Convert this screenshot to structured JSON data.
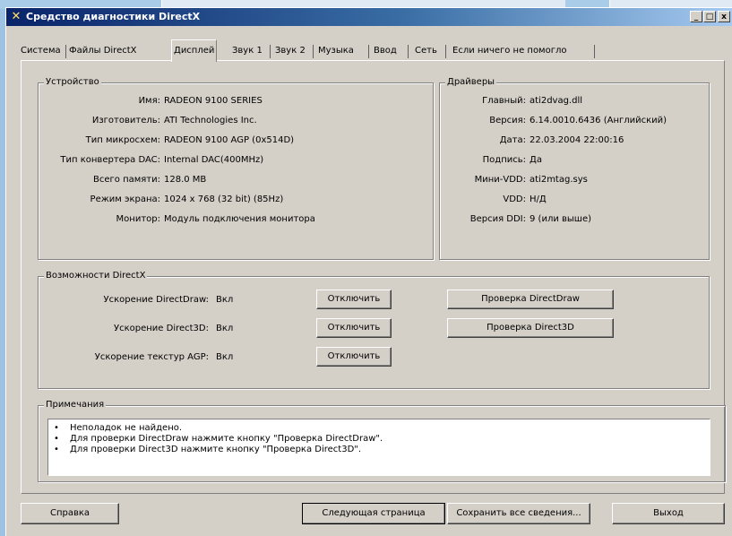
{
  "window": {
    "title": "Средство диагностики DirectX",
    "controls": {
      "minimize": "_",
      "maximize": "□",
      "close": "x"
    }
  },
  "tabs": [
    "Система",
    "Файлы DirectX",
    "Дисплей",
    "Звук 1",
    "Звук 2",
    "Музыка",
    "Ввод",
    "Сеть",
    "Если ничего не помогло"
  ],
  "active_tab": "Дисплей",
  "device": {
    "title": "Устройство",
    "rows": [
      {
        "label": "Имя:",
        "value": "RADEON 9100 SERIES"
      },
      {
        "label": "Изготовитель:",
        "value": "ATI Technologies Inc."
      },
      {
        "label": "Тип микросхем:",
        "value": "RADEON 9100 AGP (0x514D)"
      },
      {
        "label": "Тип конвертера DAC:",
        "value": "Internal DAC(400MHz)"
      },
      {
        "label": "Всего памяти:",
        "value": "128.0 MB"
      },
      {
        "label": "Режим экрана:",
        "value": "1024 x 768 (32 bit) (85Hz)"
      },
      {
        "label": "Монитор:",
        "value": "Модуль подключения монитора"
      }
    ]
  },
  "drivers": {
    "title": "Драйверы",
    "rows": [
      {
        "label": "Главный:",
        "value": "ati2dvag.dll"
      },
      {
        "label": "Версия:",
        "value": "6.14.0010.6436 (Английский)"
      },
      {
        "label": "Дата:",
        "value": "22.03.2004 22:00:16"
      },
      {
        "label": "Подпись:",
        "value": "Да"
      },
      {
        "label": "Мини-VDD:",
        "value": "ati2mtag.sys"
      },
      {
        "label": "VDD:",
        "value": "Н/Д"
      },
      {
        "label": "Версия DDI:",
        "value": "9 (или выше)"
      }
    ]
  },
  "features": {
    "title": "Возможности DirectX",
    "rows": [
      {
        "label": "Ускорение DirectDraw:",
        "value": "Вкл",
        "button": "Отключить"
      },
      {
        "label": "Ускорение Direct3D:",
        "value": "Вкл",
        "button": "Отключить"
      },
      {
        "label": "Ускорение текстур AGP:",
        "value": "Вкл",
        "button": "Отключить"
      }
    ],
    "test_directdraw": "Проверка DirectDraw",
    "test_direct3d": "Проверка Direct3D"
  },
  "notes": {
    "title": "Примечания",
    "bullet": "•",
    "lines": [
      "Неполадок не найдено.",
      "Для проверки DirectDraw нажмите кнопку \"Проверка DirectDraw\".",
      "Для проверки Direct3D нажмите кнопку \"Проверка Direct3D\"."
    ]
  },
  "footer": {
    "help": "Справка",
    "next_page": "Следующая страница",
    "save_all": "Сохранить все сведения...",
    "exit": "Выход"
  }
}
